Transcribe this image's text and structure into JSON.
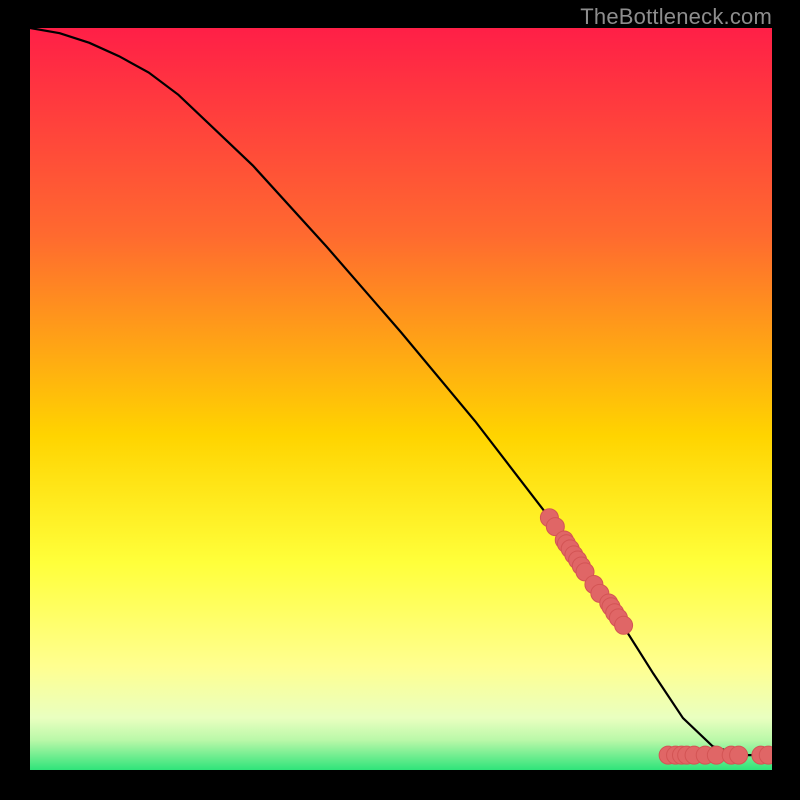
{
  "watermark": "TheBottleneck.com",
  "chart_data": {
    "type": "line",
    "title": "",
    "xlabel": "",
    "ylabel": "",
    "xlim": [
      0,
      100
    ],
    "ylim": [
      0,
      100
    ],
    "curve": {
      "x": [
        0,
        4,
        8,
        12,
        16,
        20,
        30,
        40,
        50,
        60,
        70,
        78,
        84,
        88,
        92,
        96,
        100
      ],
      "y": [
        100,
        99.3,
        98,
        96.2,
        94,
        91,
        81.5,
        70.5,
        59,
        47,
        34,
        22.5,
        13,
        7,
        3.2,
        2,
        2
      ]
    },
    "markers_on_curve": {
      "x": [
        70.0,
        70.8,
        72.0,
        72.3,
        72.8,
        73.3,
        73.8,
        74.3,
        74.8,
        76.0,
        76.8,
        78.0,
        78.3,
        78.8,
        79.3,
        80.0
      ],
      "y": [
        34.0,
        32.8,
        31.0,
        30.5,
        29.8,
        29.0,
        28.3,
        27.5,
        26.7,
        25.0,
        23.8,
        22.5,
        22.0,
        21.2,
        20.5,
        19.5
      ]
    },
    "markers_flat": {
      "x": [
        86.0,
        87.0,
        87.8,
        88.5,
        89.5,
        91.0,
        92.5,
        94.5,
        95.5,
        98.5,
        99.5
      ],
      "y": [
        2.0,
        2.0,
        2.0,
        2.0,
        2.0,
        2.0,
        2.0,
        2.0,
        2.0,
        2.0,
        2.0
      ]
    },
    "colors": {
      "gradient_top": "#ff1f47",
      "gradient_mid_upper": "#ff7a2a",
      "gradient_mid": "#ffd400",
      "gradient_lower": "#ffff66",
      "gradient_pale": "#f8ffb8",
      "gradient_bottom": "#2fe47a",
      "curve": "#000000",
      "marker_fill": "#e06666",
      "marker_stroke": "#d35454"
    },
    "gradient_stops": [
      {
        "offset": 0,
        "color": "#ff1f47"
      },
      {
        "offset": 28,
        "color": "#ff6a2f"
      },
      {
        "offset": 55,
        "color": "#ffd400"
      },
      {
        "offset": 72,
        "color": "#ffff3a"
      },
      {
        "offset": 86,
        "color": "#ffff90"
      },
      {
        "offset": 93,
        "color": "#e9ffc0"
      },
      {
        "offset": 96,
        "color": "#b9f8a8"
      },
      {
        "offset": 100,
        "color": "#2fe47a"
      }
    ],
    "marker_radius": 9
  }
}
